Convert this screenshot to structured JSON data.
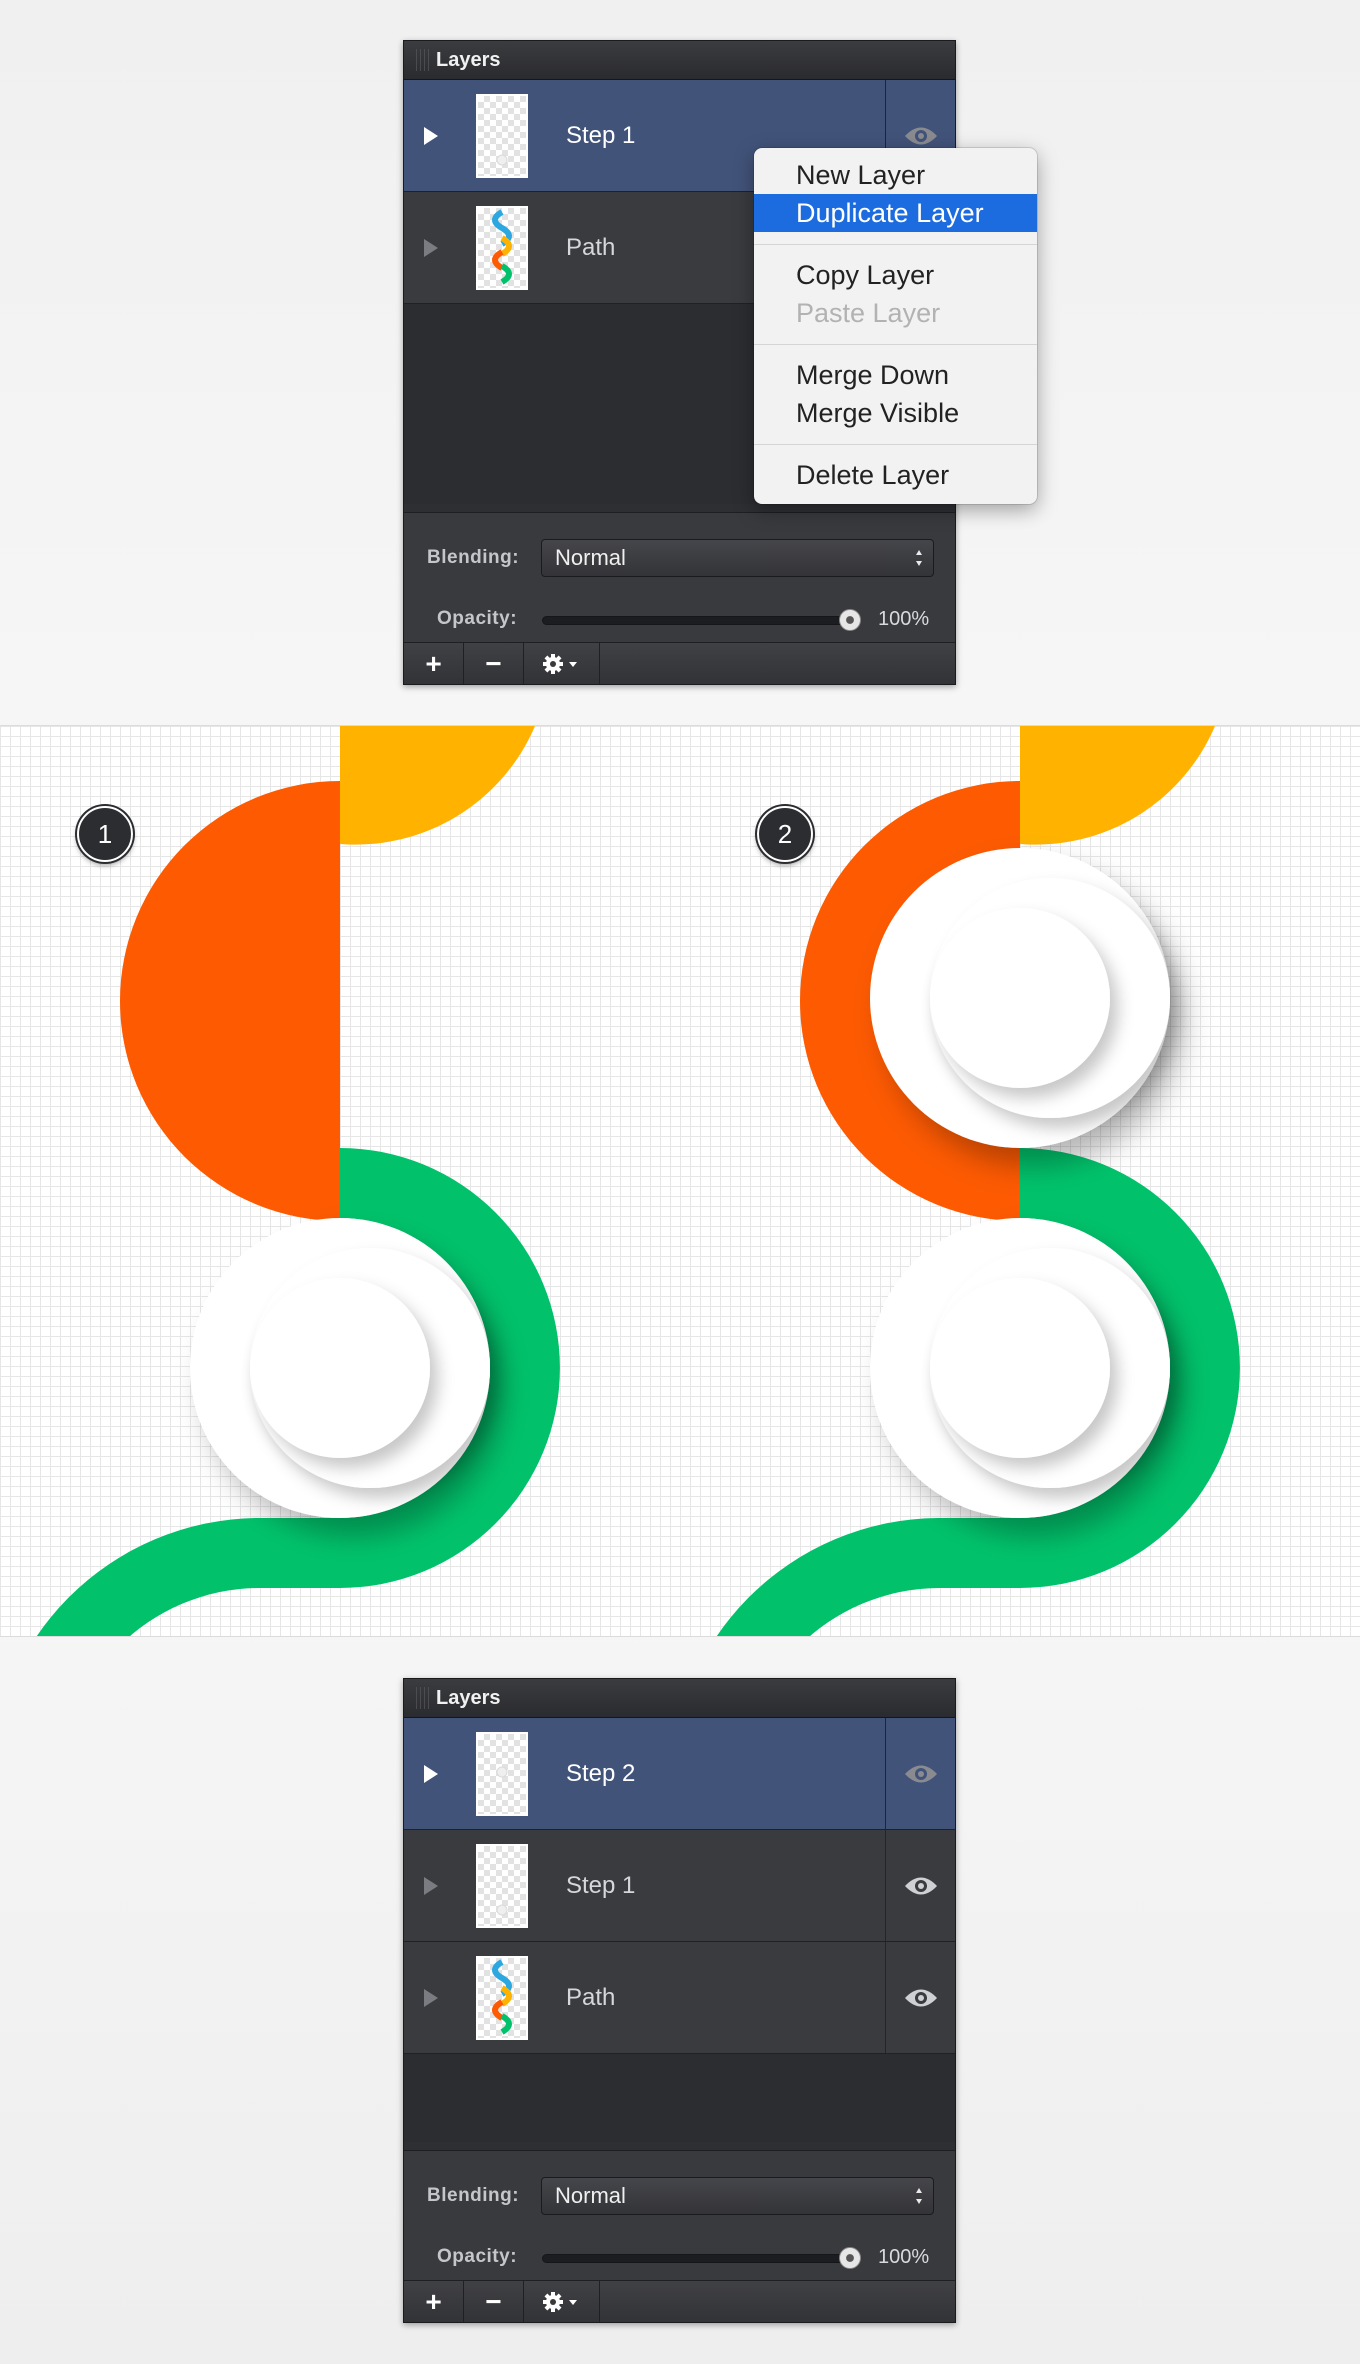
{
  "panel_top": {
    "title": "Layers",
    "layers": [
      {
        "name": "Step 1",
        "selected": true,
        "thumbnail": "step-thumbnail"
      },
      {
        "name": "Path",
        "selected": false,
        "thumbnail": "path-thumbnail"
      }
    ],
    "blending_label": "Blending:",
    "blending_value": "Normal",
    "opacity_label": "Opacity:",
    "opacity_value": "100%",
    "opacity_fraction": 1.0,
    "toolbar": {
      "add": "+",
      "remove": "−",
      "gear_icon": "gear-icon"
    }
  },
  "context_menu": {
    "items": [
      {
        "label": "New Layer",
        "state": "normal"
      },
      {
        "label": "Duplicate Layer",
        "state": "active"
      },
      {
        "label": "Copy Layer",
        "state": "normal"
      },
      {
        "label": "Paste Layer",
        "state": "disabled"
      },
      {
        "label": "Merge Down",
        "state": "normal"
      },
      {
        "label": "Merge Visible",
        "state": "normal"
      },
      {
        "label": "Delete Layer",
        "state": "normal"
      }
    ]
  },
  "canvas": {
    "steps": [
      "1",
      "2"
    ],
    "colors": {
      "orange": "#fd5a02",
      "yellow": "#ffb300",
      "green": "#01c26b",
      "white": "#ffffff"
    }
  },
  "panel_bottom": {
    "title": "Layers",
    "layers": [
      {
        "name": "Step 2",
        "selected": true,
        "thumbnail": "step-thumbnail"
      },
      {
        "name": "Step 1",
        "selected": false,
        "thumbnail": "step-thumbnail"
      },
      {
        "name": "Path",
        "selected": false,
        "thumbnail": "path-thumbnail"
      }
    ],
    "blending_label": "Blending:",
    "blending_value": "Normal",
    "opacity_label": "Opacity:",
    "opacity_value": "100%",
    "opacity_fraction": 1.0,
    "toolbar": {
      "add": "+",
      "remove": "−",
      "gear_icon": "gear-icon"
    }
  }
}
